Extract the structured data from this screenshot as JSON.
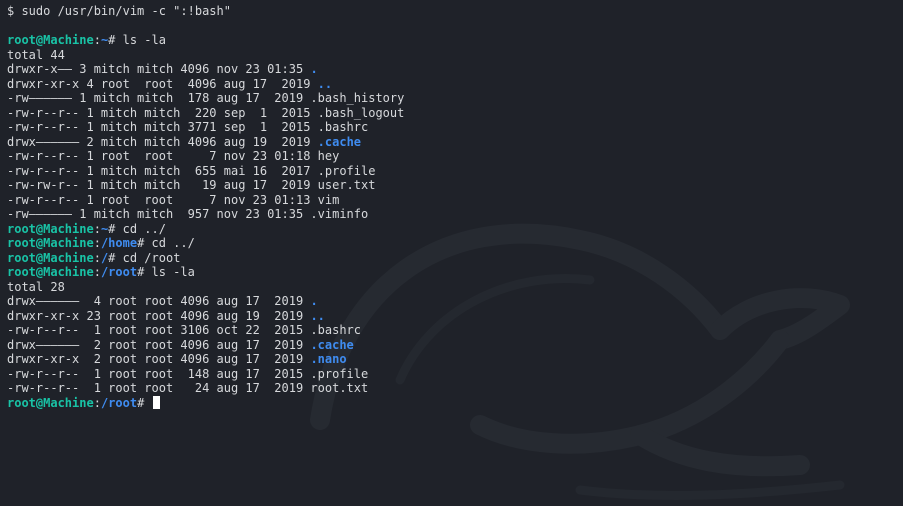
{
  "colors": {
    "background": "#1f2229",
    "text": "#d7d9dc",
    "prompt_user": "#19c3a6",
    "path": "#3f8cf0",
    "directory": "#3f8cf0"
  },
  "lines": [
    {
      "segments": [
        {
          "t": "$ sudo /usr/bin/vim -c \":!bash\"",
          "c": "text"
        }
      ]
    },
    {
      "segments": []
    },
    {
      "segments": [
        {
          "t": "root@Machine",
          "c": "user"
        },
        {
          "t": ":",
          "c": "text"
        },
        {
          "t": "~",
          "c": "path"
        },
        {
          "t": "# ls -la",
          "c": "text"
        }
      ]
    },
    {
      "segments": [
        {
          "t": "total 44",
          "c": "text"
        }
      ]
    },
    {
      "segments": [
        {
          "t": "drwxr-x—— 3 mitch mitch 4096 nov 23 01:35 ",
          "c": "text"
        },
        {
          "t": ".",
          "c": "dir"
        }
      ]
    },
    {
      "segments": [
        {
          "t": "drwxr-xr-x 4 root  root  4096 aug 17  2019 ",
          "c": "text"
        },
        {
          "t": "..",
          "c": "dir"
        }
      ]
    },
    {
      "segments": [
        {
          "t": "-rw—————— 1 mitch mitch  178 aug 17  2019 .bash_history",
          "c": "text"
        }
      ]
    },
    {
      "segments": [
        {
          "t": "-rw-r--r-- 1 mitch mitch  220 sep  1  2015 .bash_logout",
          "c": "text"
        }
      ]
    },
    {
      "segments": [
        {
          "t": "-rw-r--r-- 1 mitch mitch 3771 sep  1  2015 .bashrc",
          "c": "text"
        }
      ]
    },
    {
      "segments": [
        {
          "t": "drwx—————— 2 mitch mitch 4096 aug 19  2019 ",
          "c": "text"
        },
        {
          "t": ".cache",
          "c": "dir"
        }
      ]
    },
    {
      "segments": [
        {
          "t": "-rw-r--r-- 1 root  root     7 nov 23 01:18 hey",
          "c": "text"
        }
      ]
    },
    {
      "segments": [
        {
          "t": "-rw-r--r-- 1 mitch mitch  655 mai 16  2017 .profile",
          "c": "text"
        }
      ]
    },
    {
      "segments": [
        {
          "t": "-rw-rw-r-- 1 mitch mitch   19 aug 17  2019 user.txt",
          "c": "text"
        }
      ]
    },
    {
      "segments": [
        {
          "t": "-rw-r--r-- 1 root  root     7 nov 23 01:13 vim",
          "c": "text"
        }
      ]
    },
    {
      "segments": [
        {
          "t": "-rw—————— 1 mitch mitch  957 nov 23 01:35 .viminfo",
          "c": "text"
        }
      ]
    },
    {
      "segments": [
        {
          "t": "root@Machine",
          "c": "user"
        },
        {
          "t": ":",
          "c": "text"
        },
        {
          "t": "~",
          "c": "path"
        },
        {
          "t": "# cd ../",
          "c": "text"
        }
      ]
    },
    {
      "segments": [
        {
          "t": "root@Machine",
          "c": "user"
        },
        {
          "t": ":",
          "c": "text"
        },
        {
          "t": "/home",
          "c": "path"
        },
        {
          "t": "# cd ../",
          "c": "text"
        }
      ]
    },
    {
      "segments": [
        {
          "t": "root@Machine",
          "c": "user"
        },
        {
          "t": ":",
          "c": "text"
        },
        {
          "t": "/",
          "c": "path"
        },
        {
          "t": "# cd /root",
          "c": "text"
        }
      ]
    },
    {
      "segments": [
        {
          "t": "root@Machine",
          "c": "user"
        },
        {
          "t": ":",
          "c": "text"
        },
        {
          "t": "/root",
          "c": "path"
        },
        {
          "t": "# ls -la",
          "c": "text"
        }
      ]
    },
    {
      "segments": [
        {
          "t": "total 28",
          "c": "text"
        }
      ]
    },
    {
      "segments": [
        {
          "t": "drwx——————  4 root root 4096 aug 17  2019 ",
          "c": "text"
        },
        {
          "t": ".",
          "c": "dir"
        }
      ]
    },
    {
      "segments": [
        {
          "t": "drwxr-xr-x 23 root root 4096 aug 19  2019 ",
          "c": "text"
        },
        {
          "t": "..",
          "c": "dir"
        }
      ]
    },
    {
      "segments": [
        {
          "t": "-rw-r--r--  1 root root 3106 oct 22  2015 .bashrc",
          "c": "text"
        }
      ]
    },
    {
      "segments": [
        {
          "t": "drwx——————  2 root root 4096 aug 17  2019 ",
          "c": "text"
        },
        {
          "t": ".cache",
          "c": "dir"
        }
      ]
    },
    {
      "segments": [
        {
          "t": "drwxr-xr-x  2 root root 4096 aug 17  2019 ",
          "c": "text"
        },
        {
          "t": ".nano",
          "c": "dir"
        }
      ]
    },
    {
      "segments": [
        {
          "t": "-rw-r--r--  1 root root  148 aug 17  2015 .profile",
          "c": "text"
        }
      ]
    },
    {
      "segments": [
        {
          "t": "-rw-r--r--  1 root root   24 aug 17  2019 root.txt",
          "c": "text"
        }
      ]
    },
    {
      "segments": [
        {
          "t": "root@Machine",
          "c": "user"
        },
        {
          "t": ":",
          "c": "text"
        },
        {
          "t": "/root",
          "c": "path"
        },
        {
          "t": "# ",
          "c": "text"
        }
      ],
      "cursor": true
    }
  ]
}
